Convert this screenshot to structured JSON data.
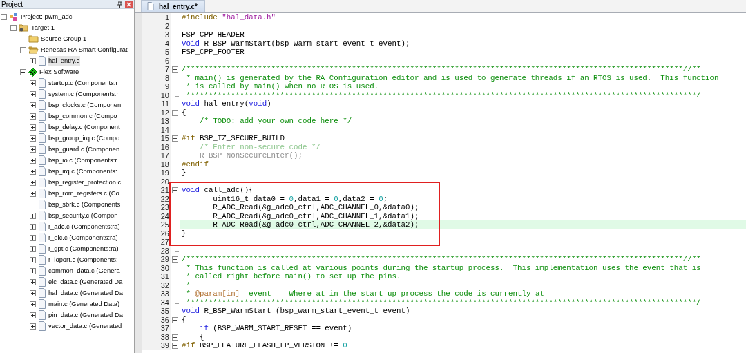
{
  "project_panel": {
    "title": "Project",
    "tree": [
      {
        "label": "Project: pwm_adc",
        "kind": "project",
        "expanded": true,
        "selected": false,
        "children": [
          {
            "label": "Target 1",
            "kind": "target",
            "expanded": true,
            "selected": false,
            "children": [
              {
                "label": "Source Group 1",
                "kind": "folder",
                "selected": false
              },
              {
                "label": "Renesas RA Smart Configurat",
                "kind": "folder_open",
                "expanded": true,
                "selected": false,
                "children": [
                  {
                    "label": "hal_entry.c",
                    "kind": "file",
                    "expanded": false,
                    "selected": true
                  }
                ]
              },
              {
                "label": "Flex Software",
                "kind": "component",
                "expanded": true,
                "selected": false,
                "children": [
                  {
                    "label": "startup.c (Components:r",
                    "kind": "file",
                    "expanded": false,
                    "selected": false
                  },
                  {
                    "label": "system.c (Components:r",
                    "kind": "file",
                    "expanded": false,
                    "selected": false
                  },
                  {
                    "label": "bsp_clocks.c (Componen",
                    "kind": "file",
                    "expanded": false,
                    "selected": false
                  },
                  {
                    "label": "bsp_common.c (Compo",
                    "kind": "file",
                    "expanded": false,
                    "selected": false
                  },
                  {
                    "label": "bsp_delay.c (Component",
                    "kind": "file",
                    "expanded": false,
                    "selected": false
                  },
                  {
                    "label": "bsp_group_irq.c (Compo",
                    "kind": "file",
                    "expanded": false,
                    "selected": false
                  },
                  {
                    "label": "bsp_guard.c (Componen",
                    "kind": "file",
                    "expanded": false,
                    "selected": false
                  },
                  {
                    "label": "bsp_io.c (Components:r",
                    "kind": "file",
                    "expanded": false,
                    "selected": false
                  },
                  {
                    "label": "bsp_irq.c (Components:",
                    "kind": "file",
                    "expanded": false,
                    "selected": false
                  },
                  {
                    "label": "bsp_register_protection.c",
                    "kind": "file",
                    "expanded": false,
                    "selected": false
                  },
                  {
                    "label": "bsp_rom_registers.c (Co",
                    "kind": "file",
                    "expanded": false,
                    "selected": false
                  },
                  {
                    "label": "bsp_sbrk.c (Components",
                    "kind": "file",
                    "selected": false
                  },
                  {
                    "label": "bsp_security.c (Compon",
                    "kind": "file",
                    "expanded": false,
                    "selected": false
                  },
                  {
                    "label": "r_adc.c (Components:ra)",
                    "kind": "file",
                    "expanded": false,
                    "selected": false
                  },
                  {
                    "label": "r_elc.c (Components:ra)",
                    "kind": "file",
                    "expanded": false,
                    "selected": false
                  },
                  {
                    "label": "r_gpt.c (Components:ra)",
                    "kind": "file",
                    "expanded": false,
                    "selected": false
                  },
                  {
                    "label": "r_ioport.c (Components:",
                    "kind": "file",
                    "expanded": false,
                    "selected": false
                  },
                  {
                    "label": "common_data.c (Genera",
                    "kind": "file",
                    "expanded": false,
                    "selected": false
                  },
                  {
                    "label": "elc_data.c (Generated Da",
                    "kind": "file",
                    "expanded": false,
                    "selected": false
                  },
                  {
                    "label": "hal_data.c (Generated Da",
                    "kind": "file",
                    "expanded": false,
                    "selected": false
                  },
                  {
                    "label": "main.c (Generated Data)",
                    "kind": "file",
                    "expanded": false,
                    "selected": false
                  },
                  {
                    "label": "pin_data.c (Generated Da",
                    "kind": "file",
                    "expanded": false,
                    "selected": false
                  },
                  {
                    "label": "vector_data.c (Generated",
                    "kind": "file",
                    "expanded": false,
                    "selected": false
                  }
                ]
              }
            ]
          }
        ]
      }
    ]
  },
  "editor": {
    "tabs": [
      {
        "label": "hal_entry.c*",
        "selected": true
      }
    ],
    "sections": [
      {
        "kind": "plain",
        "lines": [
          {
            "number": "1",
            "kind": "plain",
            "tokens": [
              {
                "kind": "preproc",
                "text": "#include "
              },
              {
                "kind": "string",
                "text": "\"hal_data.h\""
              }
            ]
          },
          {
            "number": "2",
            "kind": "plain"
          },
          {
            "number": "3",
            "kind": "plain",
            "tokens": [
              {
                "kind": "plain",
                "text": "FSP_CPP_HEADER"
              }
            ]
          },
          {
            "number": "4",
            "kind": "plain",
            "tokens": [
              {
                "kind": "keyword",
                "text": "void"
              },
              {
                "kind": "plain",
                "text": " R_BSP_WarmStart(bsp_warm_start_event_t event);"
              }
            ]
          },
          {
            "number": "5",
            "kind": "plain",
            "tokens": [
              {
                "kind": "plain",
                "text": "FSP_CPP_FOOTER"
              }
            ]
          },
          {
            "number": "6",
            "kind": "plain"
          },
          {
            "number": "7",
            "kind": "fold_start",
            "tokens": [
              {
                "kind": "comment",
                "text": "/***************************************************************************************************************//**"
              }
            ]
          },
          {
            "number": "8",
            "kind": "fold_body",
            "tokens": [
              {
                "kind": "comment",
                "text": " * main() is generated by the RA Configuration editor and is used to generate threads if an RTOS is used.  This function"
              }
            ]
          },
          {
            "number": "9",
            "kind": "fold_body",
            "tokens": [
              {
                "kind": "comment",
                "text": " * is called by main() when no RTOS is used."
              }
            ]
          },
          {
            "number": "10",
            "kind": "fold_end",
            "tokens": [
              {
                "kind": "comment",
                "text": " ******************************************************************************************************************/"
              }
            ]
          },
          {
            "number": "11",
            "kind": "plain",
            "tokens": [
              {
                "kind": "keyword",
                "text": "void"
              },
              {
                "kind": "plain",
                "text": " hal_entry("
              },
              {
                "kind": "keyword",
                "text": "void"
              },
              {
                "kind": "plain",
                "text": ")"
              }
            ]
          },
          {
            "number": "12",
            "kind": "fold_start",
            "tokens": [
              {
                "kind": "plain",
                "text": "{"
              }
            ]
          },
          {
            "number": "13",
            "kind": "fold_body",
            "tokens": [
              {
                "kind": "comment",
                "text": "    /* TODO: add your own code here */"
              }
            ]
          },
          {
            "number": "14",
            "kind": "fold_body"
          },
          {
            "number": "15",
            "kind": "fold_start",
            "tokens": [
              {
                "kind": "preproc",
                "text": "#if"
              },
              {
                "kind": "plain",
                "text": " BSP_TZ_SECURE_BUILD"
              }
            ]
          },
          {
            "number": "16",
            "kind": "fold_body",
            "tokens": [
              {
                "kind": "inactive_comment",
                "text": "    /* Enter non-secure code */"
              }
            ]
          },
          {
            "number": "17",
            "kind": "fold_body",
            "tokens": [
              {
                "kind": "inactive",
                "text": "    R_BSP_NonSecureEnter();"
              }
            ]
          },
          {
            "number": "18",
            "kind": "fold_body",
            "tokens": [
              {
                "kind": "preproc",
                "text": "#endif"
              }
            ]
          },
          {
            "number": "19",
            "kind": "fold_body",
            "tokens": [
              {
                "kind": "plain",
                "text": "}"
              }
            ]
          },
          {
            "number": "20",
            "kind": "fold_end"
          }
        ]
      },
      {
        "kind": "boxed",
        "lines": [
          {
            "number": "21",
            "kind": "fold_start",
            "tokens": [
              {
                "kind": "keyword",
                "text": "void"
              },
              {
                "kind": "plain",
                "text": " call_adc(){"
              }
            ]
          },
          {
            "number": "22",
            "kind": "fold_body",
            "tokens": [
              {
                "kind": "plain",
                "text": "       uint16_t data0 = "
              },
              {
                "kind": "number",
                "text": "0"
              },
              {
                "kind": "plain",
                "text": ",data1 = "
              },
              {
                "kind": "number",
                "text": "0"
              },
              {
                "kind": "plain",
                "text": ",data2 = "
              },
              {
                "kind": "number",
                "text": "0"
              },
              {
                "kind": "plain",
                "text": ";"
              }
            ]
          },
          {
            "number": "23",
            "kind": "fold_body",
            "tokens": [
              {
                "kind": "plain",
                "text": "       R_ADC_Read(&g_adc0_ctrl,ADC_CHANNEL_0,&data0);"
              }
            ]
          },
          {
            "number": "24",
            "kind": "fold_body",
            "tokens": [
              {
                "kind": "plain",
                "text": "       R_ADC_Read(&g_adc0_ctrl,ADC_CHANNEL_1,&data1);"
              }
            ]
          },
          {
            "number": "25",
            "kind": "fold_body",
            "highlighted": true,
            "tokens": [
              {
                "kind": "plain",
                "text": "       R_ADC_Read(&g_adc0_ctrl,ADC_CHANNEL_2,&data2);"
              }
            ]
          },
          {
            "number": "26",
            "kind": "fold_body",
            "tokens": [
              {
                "kind": "plain",
                "text": "}"
              }
            ]
          },
          {
            "number": "27",
            "kind": "fold_body"
          }
        ]
      },
      {
        "kind": "plain",
        "lines": [
          {
            "number": "28",
            "kind": "fold_end"
          },
          {
            "number": "29",
            "kind": "fold_start",
            "tokens": [
              {
                "kind": "comment",
                "text": "/***************************************************************************************************************//**"
              }
            ]
          },
          {
            "number": "30",
            "kind": "fold_body",
            "tokens": [
              {
                "kind": "comment",
                "text": " * This function is called at various points during the startup process.  This implementation uses the event that is"
              }
            ]
          },
          {
            "number": "31",
            "kind": "fold_body",
            "tokens": [
              {
                "kind": "comment",
                "text": " * called right before main() to set up the pins."
              }
            ]
          },
          {
            "number": "32",
            "kind": "fold_body",
            "tokens": [
              {
                "kind": "comment",
                "text": " *"
              }
            ]
          },
          {
            "number": "33",
            "kind": "fold_body",
            "tokens": [
              {
                "kind": "comment",
                "text": " * "
              },
              {
                "kind": "doc_tag",
                "text": "@param[in]"
              },
              {
                "kind": "comment",
                "text": "  event    Where at in the start up process the code is currently at"
              }
            ]
          },
          {
            "number": "34",
            "kind": "fold_end",
            "tokens": [
              {
                "kind": "comment",
                "text": " ******************************************************************************************************************/"
              }
            ]
          },
          {
            "number": "35",
            "kind": "plain",
            "tokens": [
              {
                "kind": "keyword",
                "text": "void"
              },
              {
                "kind": "plain",
                "text": " R_BSP_WarmStart (bsp_warm_start_event_t event)"
              }
            ]
          },
          {
            "number": "36",
            "kind": "fold_start",
            "tokens": [
              {
                "kind": "plain",
                "text": "{"
              }
            ]
          },
          {
            "number": "37",
            "kind": "fold_body",
            "tokens": [
              {
                "kind": "keyword",
                "text": "    if"
              },
              {
                "kind": "plain",
                "text": " (BSP_WARM_START_RESET == event)"
              }
            ]
          },
          {
            "number": "38",
            "kind": "fold_start",
            "tokens": [
              {
                "kind": "plain",
                "text": "    {"
              }
            ]
          },
          {
            "number": "39",
            "kind": "fold_start",
            "tokens": [
              {
                "kind": "preproc",
                "text": "#if"
              },
              {
                "kind": "plain",
                "text": " BSP_FEATURE_FLASH_LP_VERSION != "
              },
              {
                "kind": "number",
                "text": "0"
              }
            ]
          }
        ]
      }
    ]
  }
}
